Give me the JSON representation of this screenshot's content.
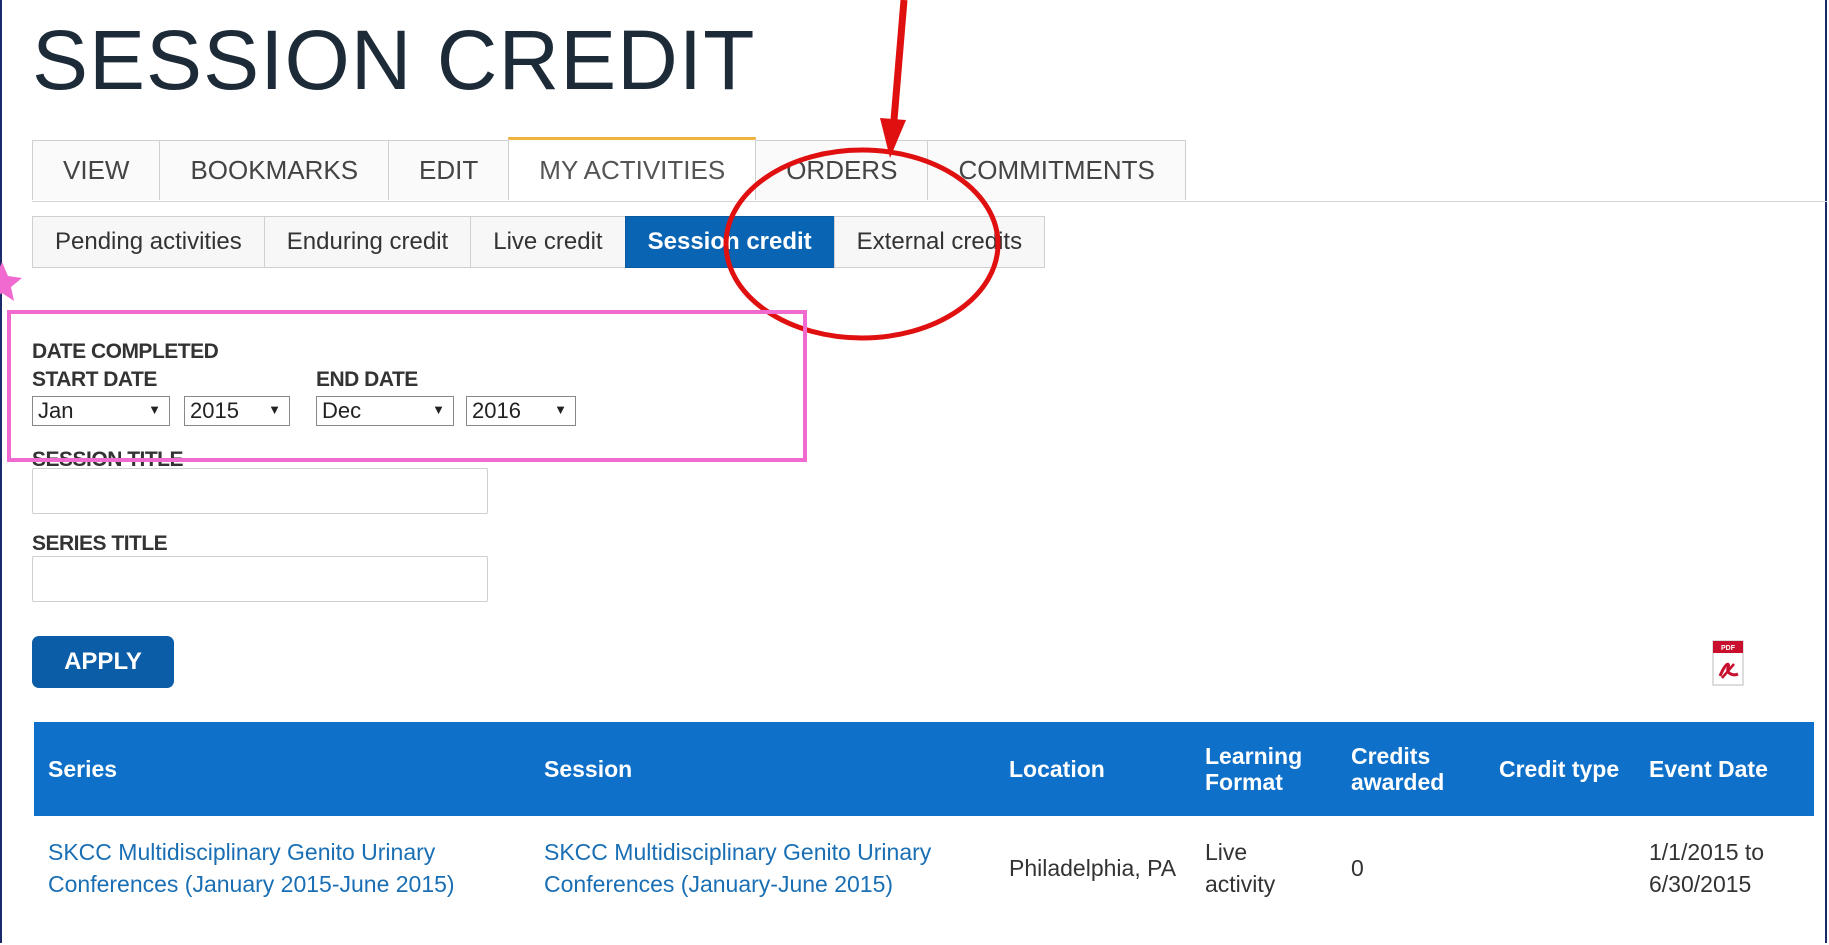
{
  "page_title": "SESSION CREDIT",
  "tabs": [
    {
      "label": "VIEW",
      "active": false
    },
    {
      "label": "BOOKMARKS",
      "active": false
    },
    {
      "label": "EDIT",
      "active": false
    },
    {
      "label": "MY ACTIVITIES",
      "active": true
    },
    {
      "label": "ORDERS",
      "active": false
    },
    {
      "label": "COMMITMENTS",
      "active": false
    }
  ],
  "subtabs": [
    {
      "label": "Pending activities",
      "active": false
    },
    {
      "label": "Enduring credit",
      "active": false
    },
    {
      "label": "Live credit",
      "active": false
    },
    {
      "label": "Session credit",
      "active": true
    },
    {
      "label": "External credits",
      "active": false
    }
  ],
  "filters": {
    "date_completed_label": "DATE COMPLETED",
    "start_date_label": "START DATE",
    "end_date_label": "END DATE",
    "start_month": "Jan",
    "start_year": "2015",
    "end_month": "Dec",
    "end_year": "2016",
    "session_title_label": "SESSION TITLE",
    "session_title_value": "",
    "series_title_label": "SERIES TITLE",
    "series_title_value": "",
    "apply_label": "APPLY"
  },
  "pdf_icon": "pdf-icon",
  "table": {
    "headers": [
      "Series",
      "Session",
      "Location",
      "Learning Format",
      "Credits awarded",
      "Credit type",
      "Event Date"
    ],
    "rows": [
      {
        "series": "SKCC Multidisciplinary Genito Urinary Conferences (January 2015-June 2015)",
        "session": "SKCC Multidisciplinary Genito Urinary Conferences (January-June 2015)",
        "location": "Philadelphia, PA",
        "format": "Live activity",
        "credits": "0",
        "credit_type": "",
        "event_date": "1/1/2015 to 6/30/2015"
      }
    ]
  },
  "colors": {
    "accent_blue": "#0a64b4",
    "header_blue": "#0e70c8",
    "annotation_red": "#e01010",
    "annotation_pink": "#f06ad0",
    "tab_active_top": "#f0b33c"
  }
}
